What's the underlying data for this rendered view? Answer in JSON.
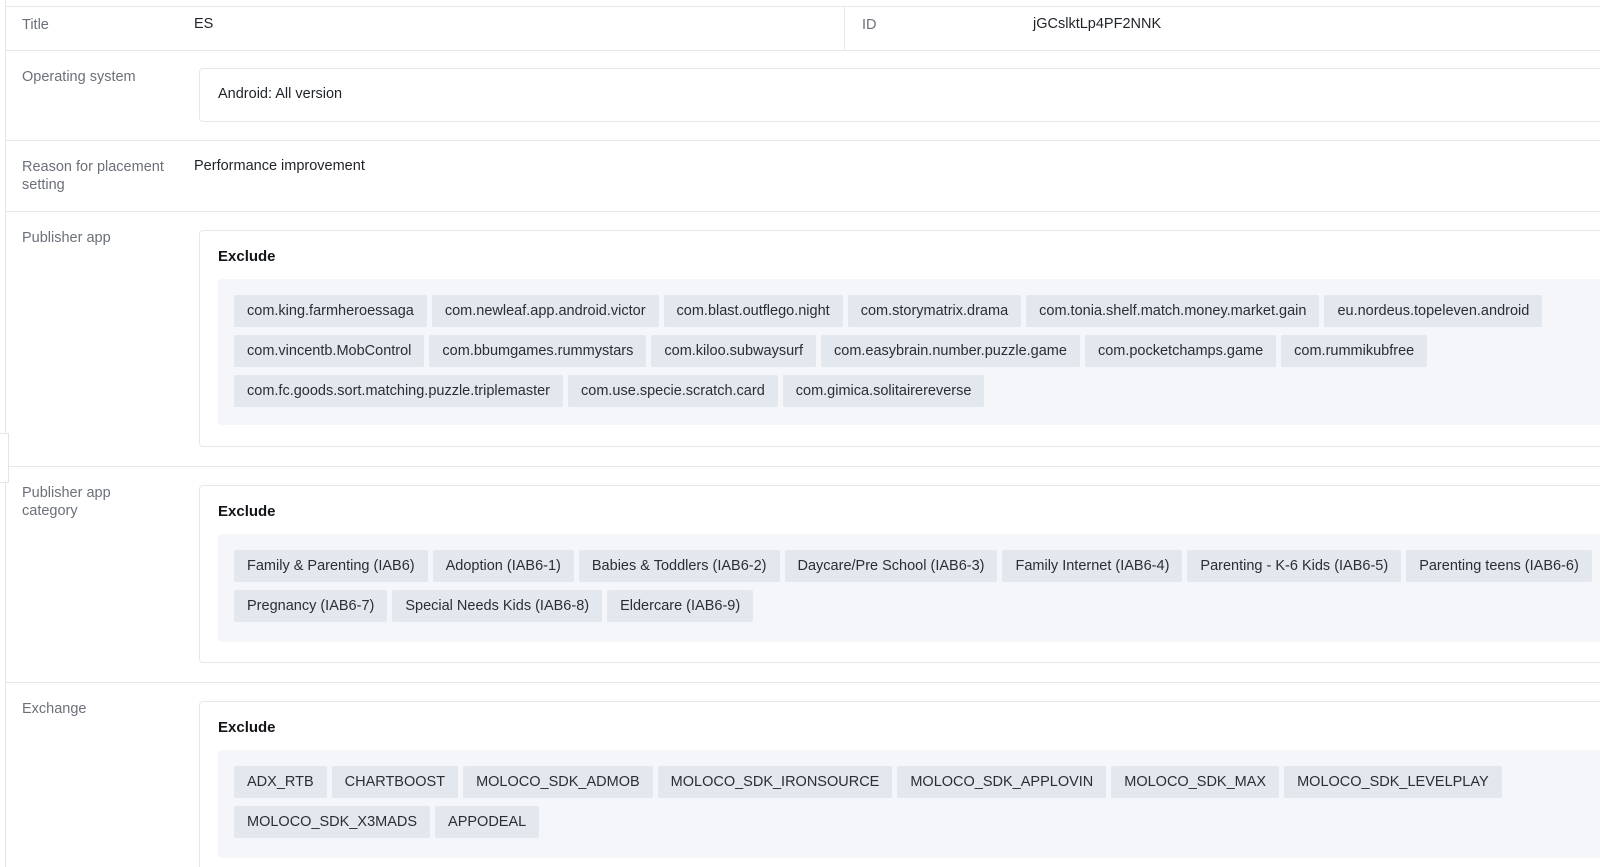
{
  "title_row": {
    "title_label": "Title",
    "title_value": "ES",
    "id_label": "ID",
    "id_value": "jGCslktLp4PF2NNK"
  },
  "os_row": {
    "label": "Operating system",
    "value": "Android: All version"
  },
  "reason_row": {
    "label_line1": "Reason for placement",
    "label_line2": "setting",
    "value": "Performance improvement"
  },
  "publisher_app": {
    "label": "Publisher app",
    "heading": "Exclude",
    "items": [
      "com.king.farmheroessaga",
      "com.newleaf.app.android.victor",
      "com.blast.outflego.night",
      "com.storymatrix.drama",
      "com.tonia.shelf.match.money.market.gain",
      "eu.nordeus.topeleven.android",
      "com.vincentb.MobControl",
      "com.bbumgames.rummystars",
      "com.kiloo.subwaysurf",
      "com.easybrain.number.puzzle.game",
      "com.pocketchamps.game",
      "com.rummikubfree",
      "com.fc.goods.sort.matching.puzzle.triplemaster",
      "com.use.specie.scratch.card",
      "com.gimica.solitairereverse"
    ]
  },
  "publisher_app_category": {
    "label_line1": "Publisher app",
    "label_line2": "category",
    "heading": "Exclude",
    "items": [
      "Family & Parenting (IAB6)",
      "Adoption (IAB6-1)",
      "Babies & Toddlers (IAB6-2)",
      "Daycare/Pre School (IAB6-3)",
      "Family Internet (IAB6-4)",
      "Parenting - K-6 Kids (IAB6-5)",
      "Parenting teens (IAB6-6)",
      "Pregnancy (IAB6-7)",
      "Special Needs Kids (IAB6-8)",
      "Eldercare (IAB6-9)"
    ]
  },
  "exchange": {
    "label": "Exchange",
    "heading": "Exclude",
    "items": [
      "ADX_RTB",
      "CHARTBOOST",
      "MOLOCO_SDK_ADMOB",
      "MOLOCO_SDK_IRONSOURCE",
      "MOLOCO_SDK_APPLOVIN",
      "MOLOCO_SDK_MAX",
      "MOLOCO_SDK_LEVELPLAY",
      "MOLOCO_SDK_X3MADS",
      "APPODEAL"
    ]
  }
}
